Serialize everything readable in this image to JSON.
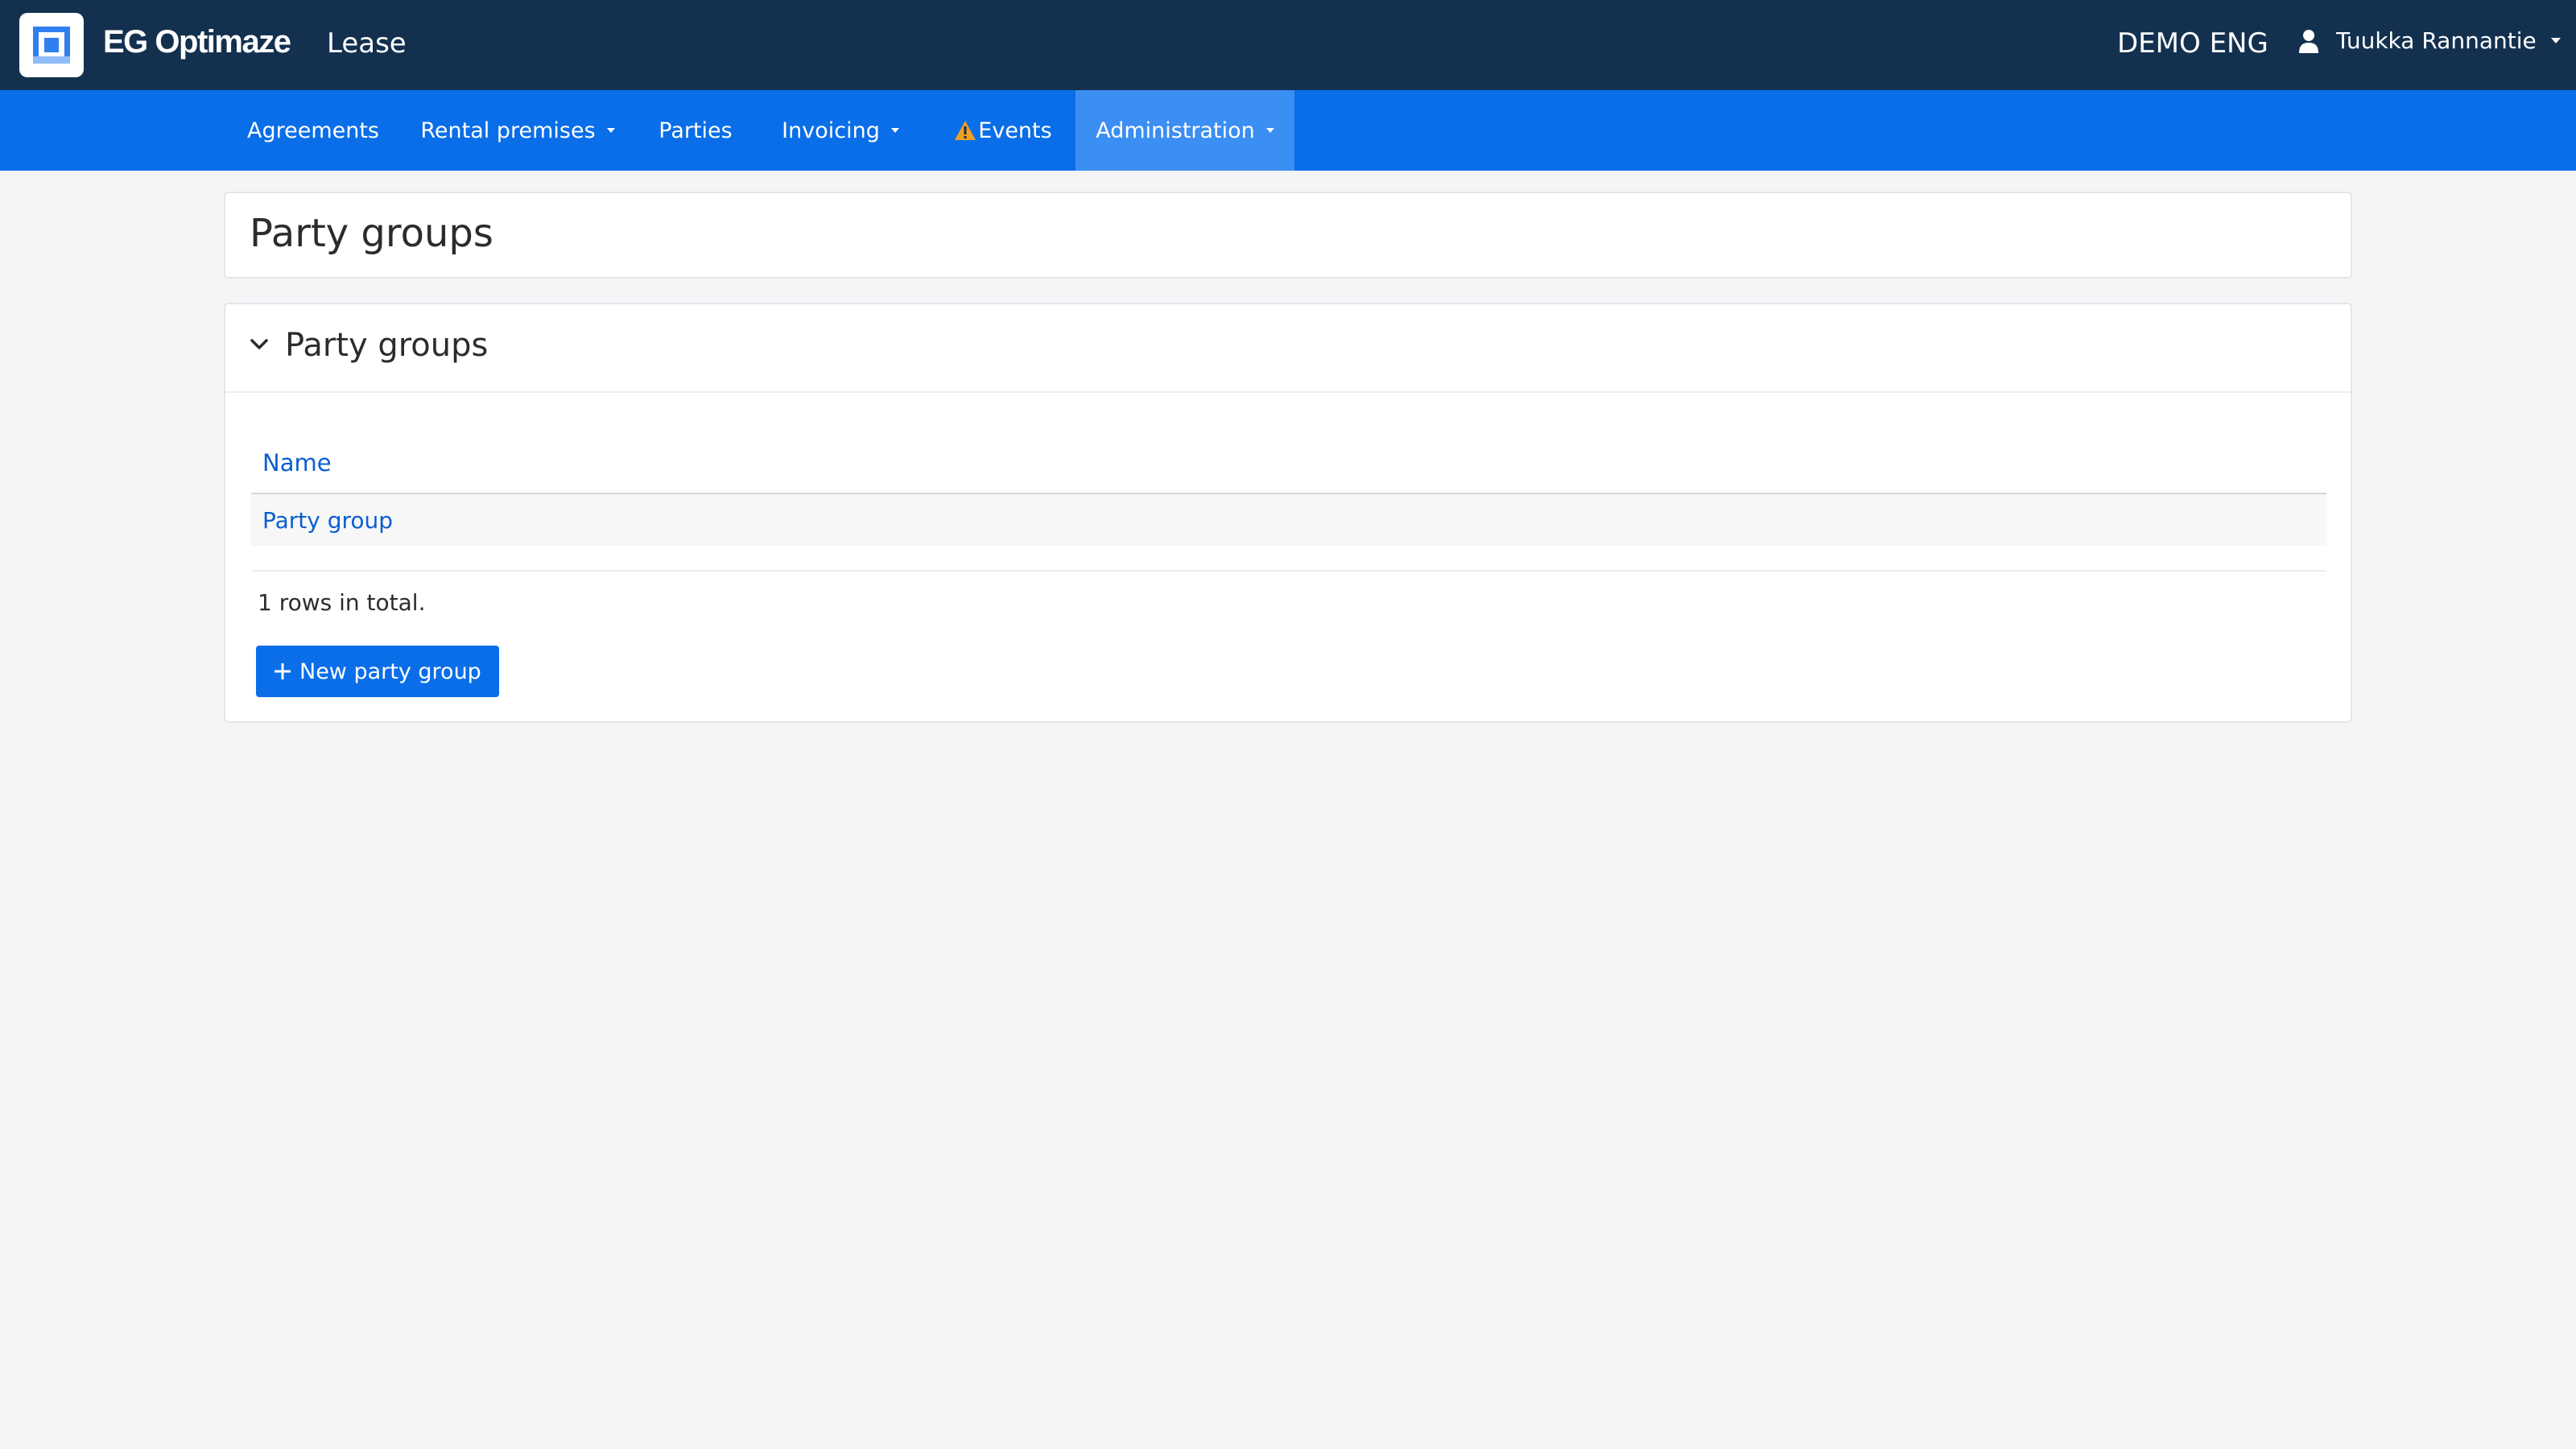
{
  "header": {
    "brand": "EG Optimaze",
    "app_name": "Lease",
    "tenant": "DEMO ENG",
    "user_name": "Tuukka Rannantie"
  },
  "nav": {
    "items": [
      {
        "label": "Agreements"
      },
      {
        "label": "Rental premises"
      },
      {
        "label": "Parties"
      },
      {
        "label": "Invoicing"
      },
      {
        "label": "Events"
      },
      {
        "label": "Administration"
      }
    ],
    "active": "Administration"
  },
  "page": {
    "title": "Party groups"
  },
  "panel": {
    "title": "Party groups",
    "columns": [
      "Name"
    ],
    "rows": [
      [
        "Party group"
      ]
    ],
    "total_text": "1 rows in total.",
    "new_button_label": "New party group"
  },
  "colors": {
    "header_bg": "#13314f",
    "nav_bg": "#0a6ee8",
    "nav_active_bg": "#3b8ef2",
    "link": "#0a5fce",
    "warning": "#f0a020"
  }
}
